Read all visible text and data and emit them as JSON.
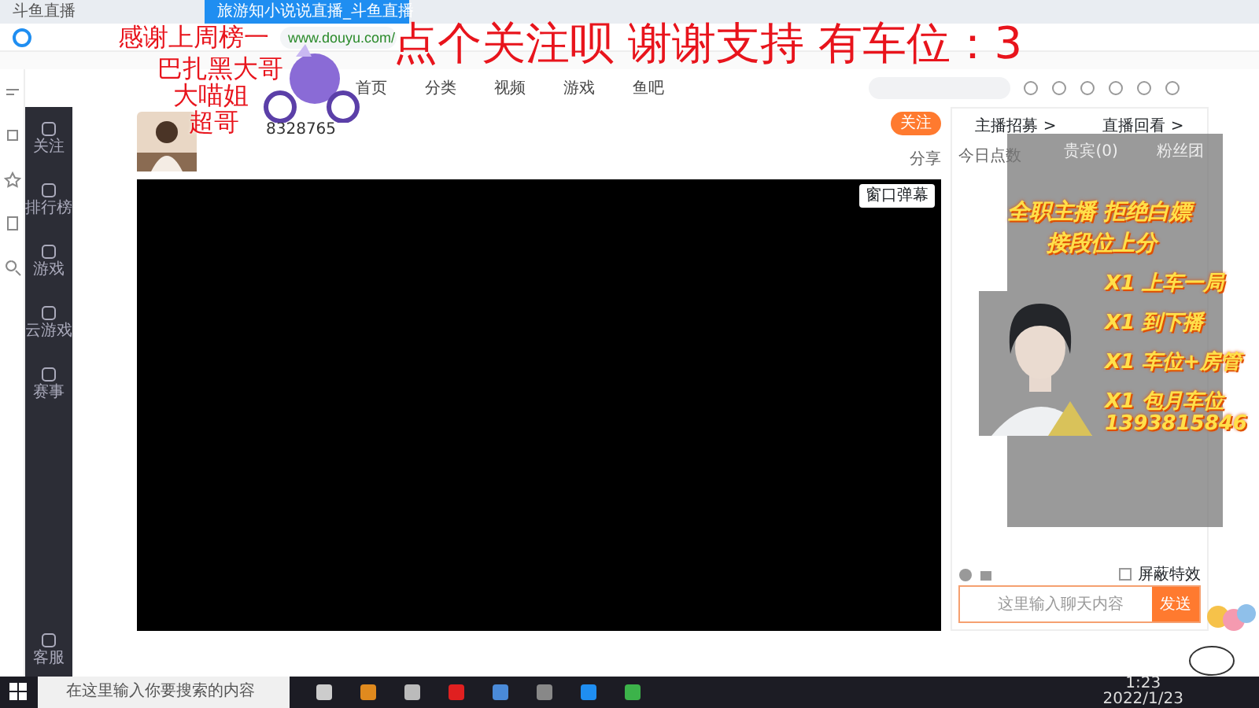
{
  "browser": {
    "tabs": [
      {
        "title": "斗鱼直播",
        "selected": false
      },
      {
        "title": "旅游知小说说直播_斗鱼直播",
        "selected": true
      }
    ],
    "address": "www.douyu.com/"
  },
  "site_nav": [
    "首页",
    "分类",
    "视频",
    "游戏",
    "鱼吧"
  ],
  "sidebar": [
    {
      "label": "关注"
    },
    {
      "label": "排行榜"
    },
    {
      "label": "游戏"
    },
    {
      "label": "云游戏"
    },
    {
      "label": "赛事"
    },
    {
      "label": "客服"
    }
  ],
  "room": {
    "id": "8328765",
    "follow": "关注",
    "share": "分享",
    "danmu": "窗口弹幕"
  },
  "side_panel": {
    "links": [
      "主播招募 >",
      "直播回看 >"
    ],
    "today": "今日点数",
    "tabs": [
      "贵宾(0)",
      "粉丝团"
    ],
    "block_effects": {
      "label": "屏蔽特效",
      "checked": false
    },
    "chat_placeholder": "这里输入聊天内容",
    "send": "发送"
  },
  "overlay": {
    "banner": "点个关注呗 谢谢支持 有车位：3",
    "thanks_title": "感谢上周榜一",
    "thanks": [
      "巴扎黑大哥",
      "大喵姐",
      "超哥"
    ],
    "promo": [
      "全职主播 拒绝白嫖",
      "接段位上分"
    ],
    "prices": [
      "X1 上车一局",
      "X1 到下播",
      "X1 车位+房管",
      "X1 包月车位"
    ],
    "contact": "1393815846"
  },
  "taskbar": {
    "search_placeholder": "在这里输入你要搜索的内容",
    "time": "1:23",
    "date": "2022/1/23"
  }
}
